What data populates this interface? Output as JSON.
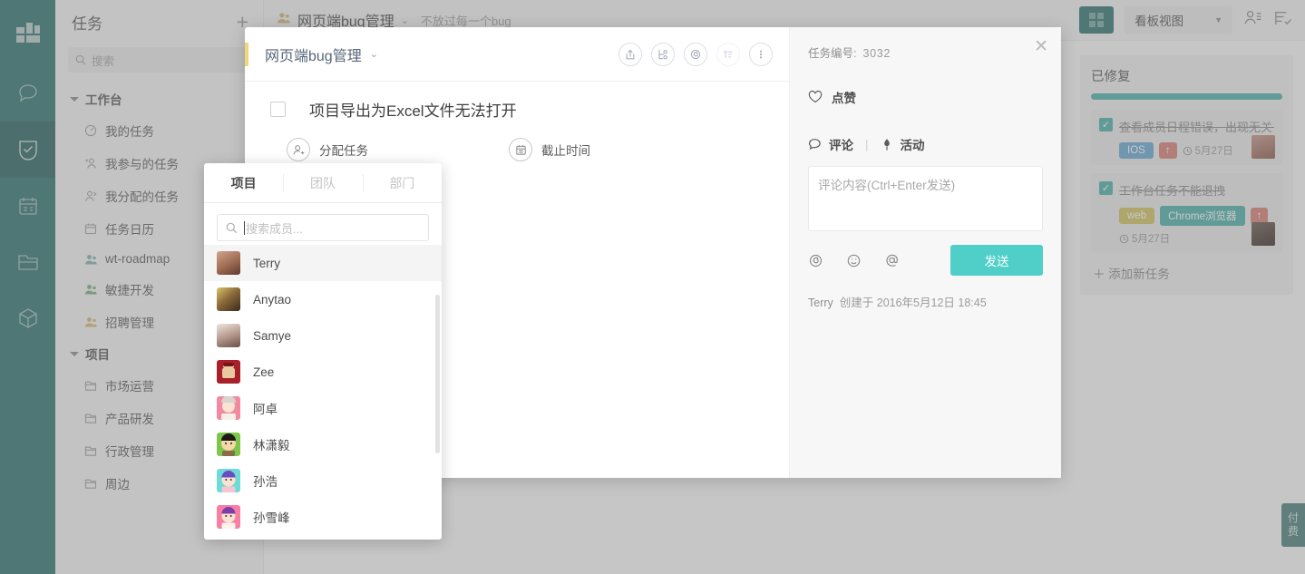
{
  "colors": {
    "rail": "#2f7471",
    "accent_teal": "#4fb2ab",
    "send_button": "#4fcfc7",
    "modal_accent": "#f2d675",
    "tag_blue": "#6aa9d6",
    "tag_khaki": "#d4c561",
    "tag_priority": "#da8176"
  },
  "rail": {
    "items": [
      {
        "name": "dashboard-icon",
        "label": "工作台"
      },
      {
        "name": "chat-icon",
        "label": "沟通"
      },
      {
        "name": "task-shield-icon",
        "label": "任务",
        "active": true
      },
      {
        "name": "calendar-icon",
        "label": "日历"
      },
      {
        "name": "folder-icon",
        "label": "文件"
      },
      {
        "name": "cube-icon",
        "label": "应用"
      }
    ]
  },
  "sidebar": {
    "title": "任务",
    "add_label": "+",
    "search_placeholder": "搜索",
    "groups": [
      {
        "label": "工作台",
        "items": [
          {
            "label": "我的任务",
            "icon": "my-task-icon"
          },
          {
            "label": "我参与的任务",
            "icon": "joined-task-icon"
          },
          {
            "label": "我分配的任务",
            "icon": "assigned-task-icon"
          },
          {
            "label": "任务日历",
            "icon": "calendar-task-icon"
          },
          {
            "label": "wt-roadmap",
            "icon": "team-icon"
          },
          {
            "label": "敏捷开发",
            "icon": "team-icon"
          },
          {
            "label": "招聘管理",
            "icon": "team-icon"
          }
        ]
      },
      {
        "label": "项目",
        "items": [
          {
            "label": "市场运营",
            "icon": "project-folder-icon"
          },
          {
            "label": "产品研发",
            "icon": "project-folder-icon"
          },
          {
            "label": "行政管理",
            "icon": "project-folder-icon"
          },
          {
            "label": "周边",
            "icon": "project-folder-icon",
            "arrow": "›"
          }
        ]
      }
    ]
  },
  "main_header": {
    "project_name": "网页端bug管理",
    "chevron": "⌄",
    "subtitle": "不放过每一个bug",
    "view_label": "看板视图",
    "view_chevron": "▼"
  },
  "board": {
    "column": {
      "title": "已修复",
      "add_task_label": "＋ 添加新任务",
      "cards": [
        {
          "checked": "✓",
          "text": "查看成员日程错误，出现无关日程",
          "tags": [
            {
              "label": "IOS",
              "style": "blue"
            }
          ],
          "priority": "↑",
          "due": "5月27日"
        },
        {
          "checked": "✓",
          "text": "工作台任务不能退拽",
          "tags": [
            {
              "label": "web",
              "style": "khaki"
            },
            {
              "label": "Chrome浏览器",
              "style": "teal"
            }
          ],
          "priority": "↑",
          "due": "5月27日"
        }
      ]
    }
  },
  "pay_tab": {
    "label_1": "付",
    "label_2": "费"
  },
  "modal": {
    "project_name": "网页端bug管理",
    "project_chevron": "⌄",
    "header_icons": [
      {
        "name": "share-icon"
      },
      {
        "name": "subtask-tree-icon"
      },
      {
        "name": "attachment-icon"
      },
      {
        "name": "priority-icon",
        "faded": true
      },
      {
        "name": "more-options-icon"
      }
    ],
    "task_title": "项目导出为Excel文件无法打开",
    "meta": [
      {
        "label": "分配任务",
        "icon": "assign-user-icon"
      },
      {
        "label": "截止时间",
        "icon": "due-date-icon"
      }
    ],
    "right": {
      "close_label": "✕",
      "task_no_label": "任务编号:",
      "task_no_value": "3032",
      "like_label": "点赞",
      "tab_comment": "评论",
      "tab_separator": "|",
      "tab_activity": "活动",
      "comment_placeholder": "评论内容(Ctrl+Enter发送)",
      "action_icons": [
        {
          "name": "attachment-icon"
        },
        {
          "name": "emoji-icon"
        },
        {
          "name": "mention-icon"
        }
      ],
      "send_label": "发送",
      "created_by": "Terry",
      "created_text": "创建于 2016年5月12日 18:45"
    }
  },
  "member_picker": {
    "tabs": [
      {
        "label": "项目",
        "active": true
      },
      {
        "label": "团队",
        "active": false
      },
      {
        "label": "部门",
        "active": false
      }
    ],
    "search_placeholder": "搜索成员...",
    "search_value": "",
    "members": [
      {
        "name": "Terry",
        "highlighted": true,
        "avatar": "photo-male-1"
      },
      {
        "name": "Anytao",
        "highlighted": false,
        "avatar": "photo-male-2"
      },
      {
        "name": "Samye",
        "highlighted": false,
        "avatar": "photo-female-1"
      },
      {
        "name": "Zee",
        "highlighted": false,
        "avatar": "cartoon-red"
      },
      {
        "name": "阿卓",
        "highlighted": false,
        "avatar": "cartoon-pink"
      },
      {
        "name": "林潇毅",
        "highlighted": false,
        "avatar": "cartoon-green"
      },
      {
        "name": "孙浩",
        "highlighted": false,
        "avatar": "cartoon-cyan"
      },
      {
        "name": "孙雪峰",
        "highlighted": false,
        "avatar": "cartoon-rose"
      }
    ]
  }
}
